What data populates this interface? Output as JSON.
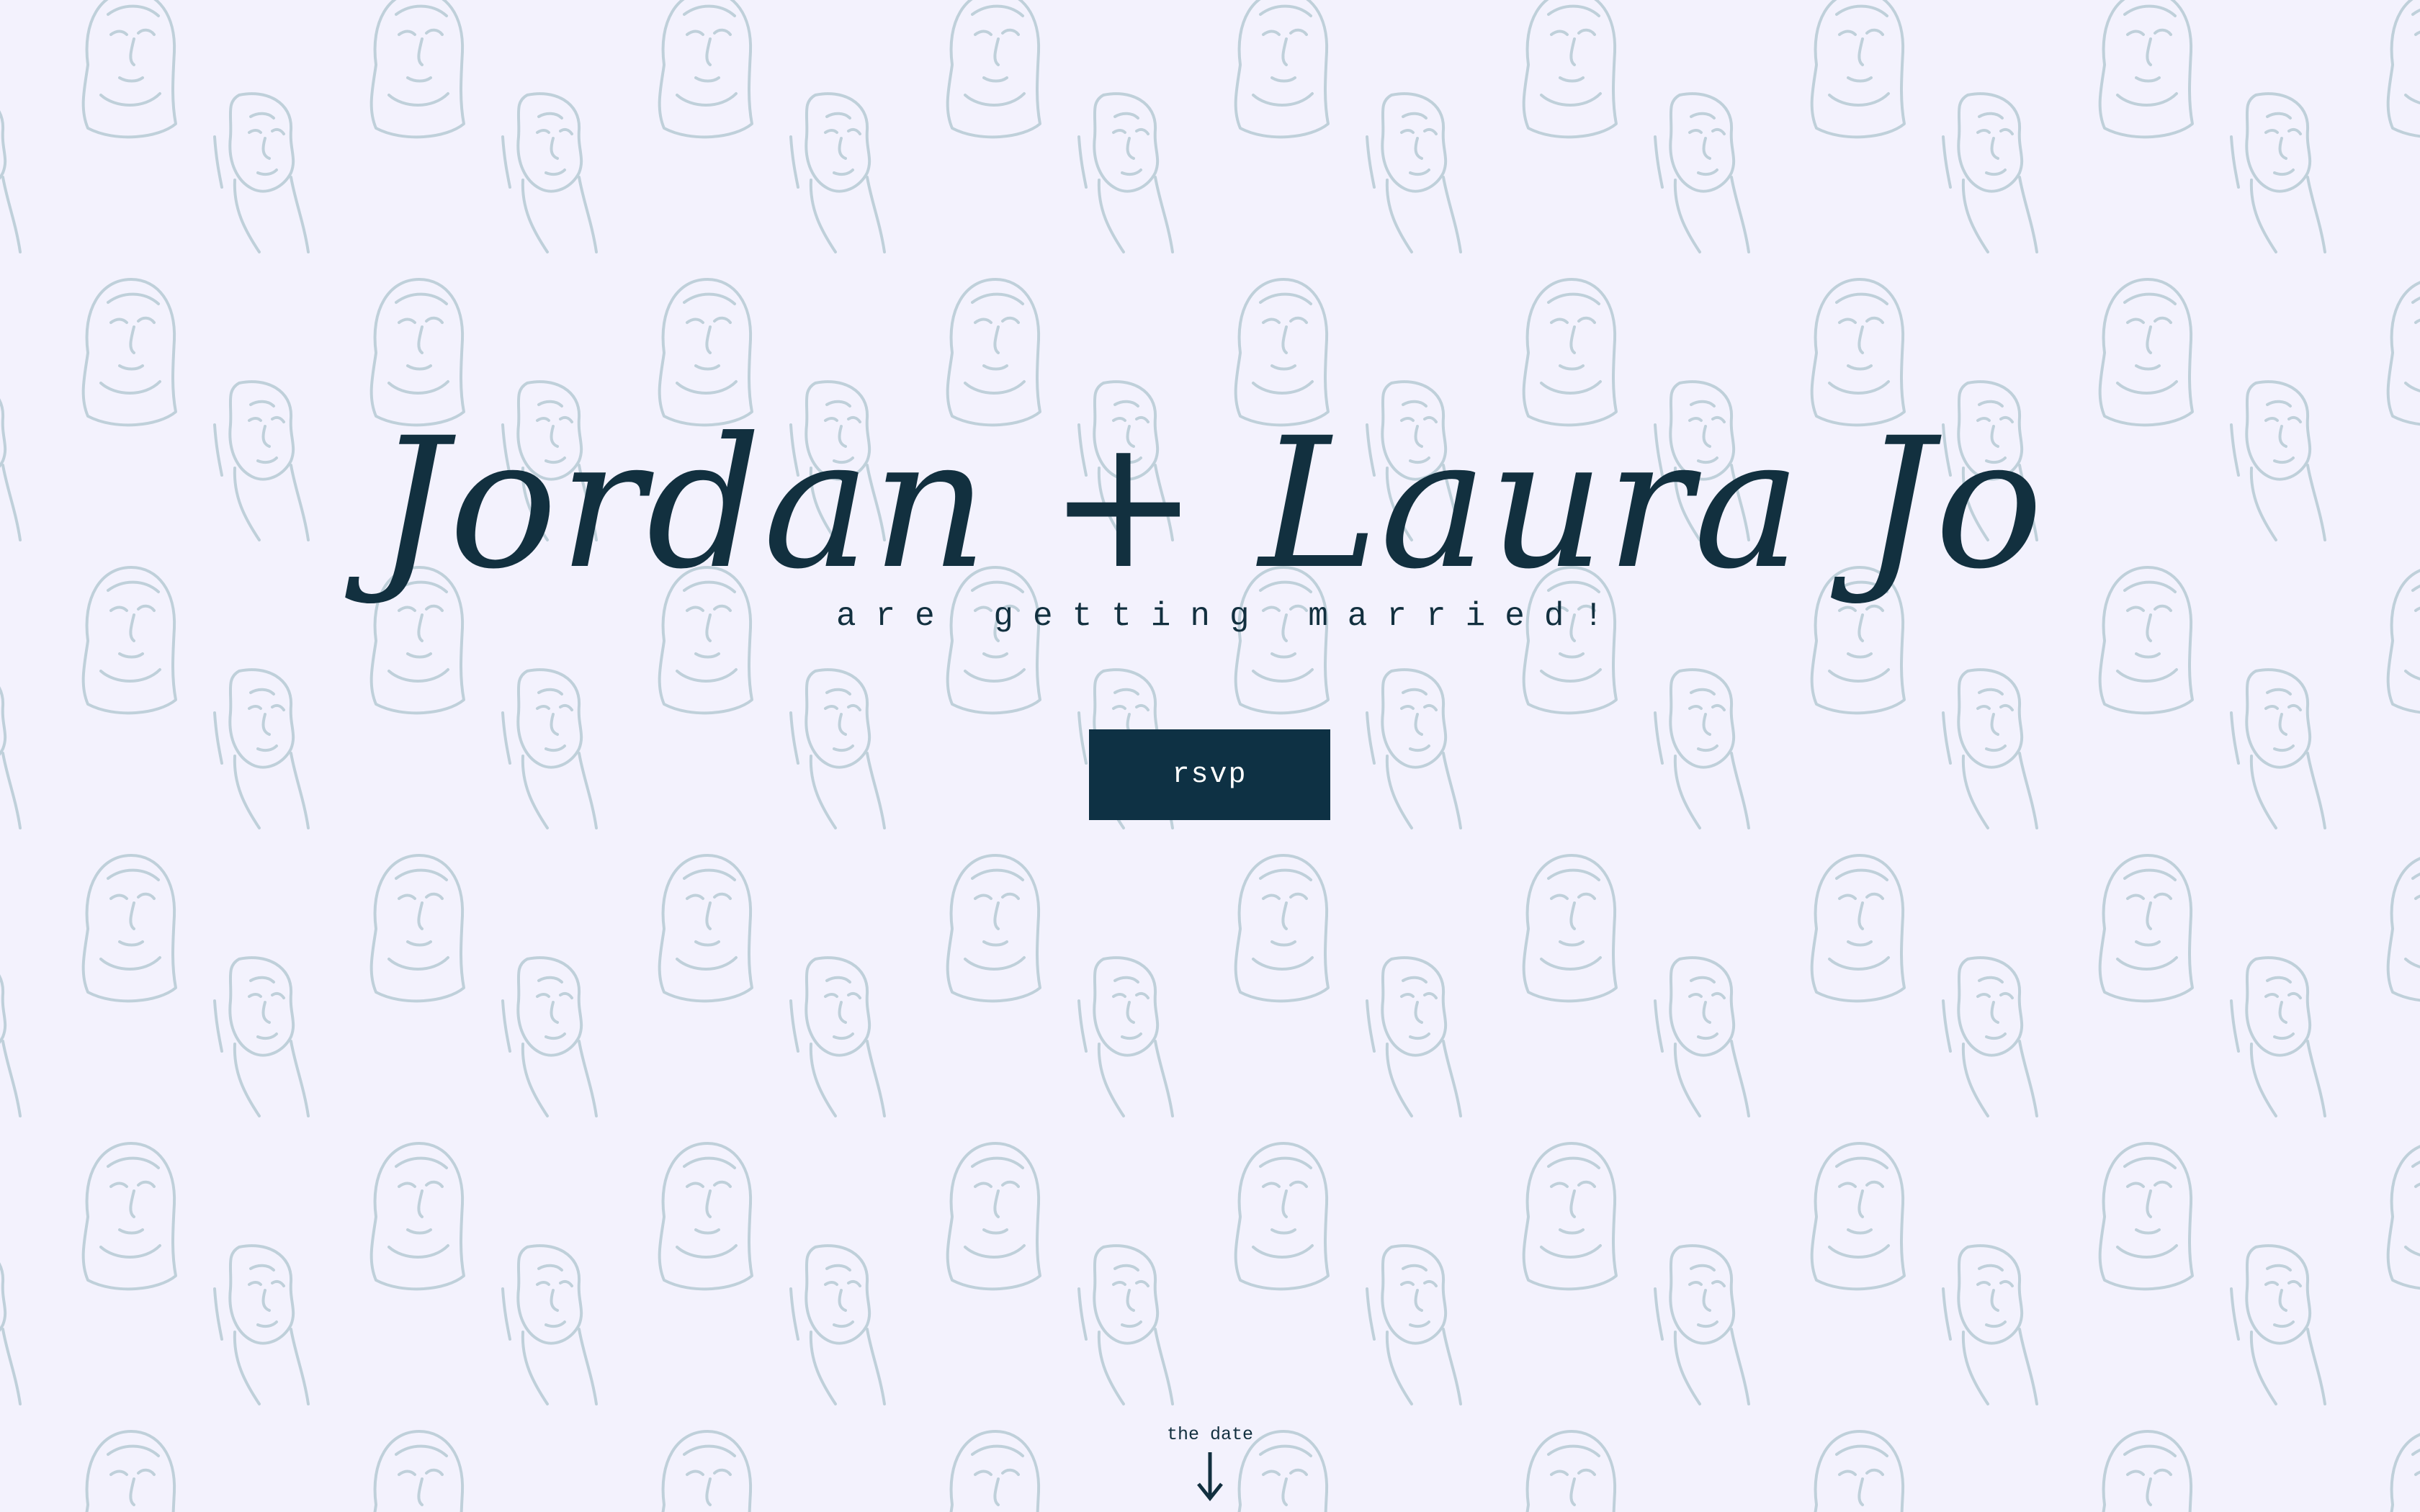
{
  "hero": {
    "names": "Jordan + Laura Jo",
    "tagline": "are getting married!",
    "rsvp_label": "rsvp"
  },
  "scroll_hint": {
    "label": "the date",
    "icon": "arrow-down-icon"
  },
  "background": {
    "pattern": "line-drawn portrait illustrations",
    "color": "#f3f2fd",
    "pattern_color": "#bfd0da"
  },
  "colors": {
    "text": "#12303f",
    "button": "#0e3144",
    "button_text": "#ffffff"
  }
}
